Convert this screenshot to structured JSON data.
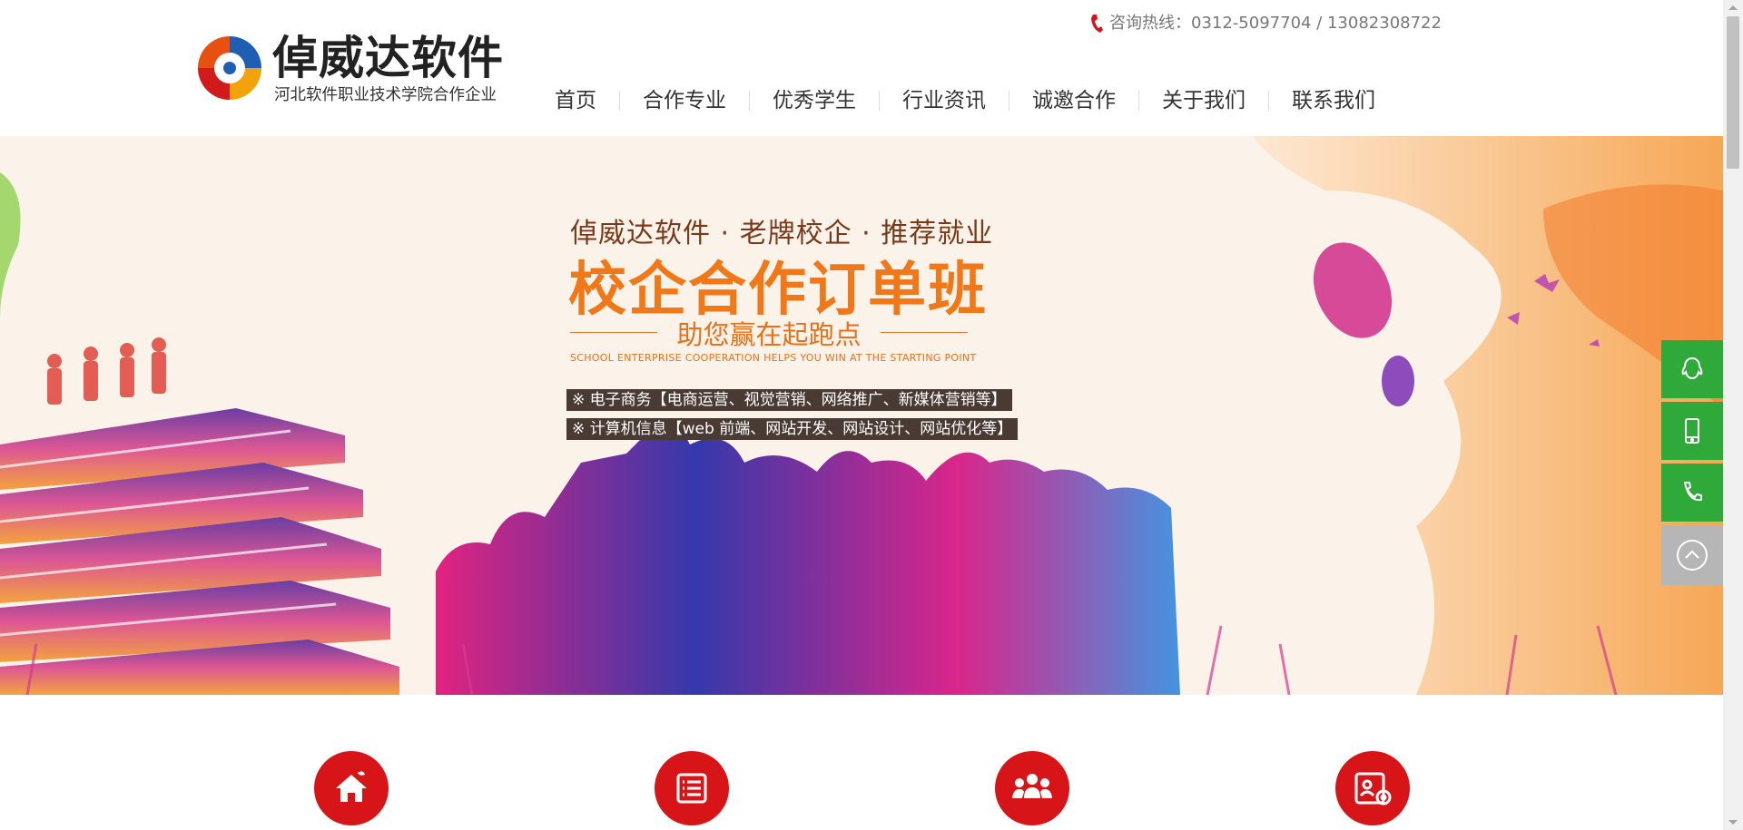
{
  "brand": {
    "name": "倬威达软件",
    "subtitle": "河北软件职业技术学院合作企业"
  },
  "hotline": {
    "text": "咨询热线：0312-5097704 / 13082308722"
  },
  "nav": {
    "items": [
      "首页",
      "合作专业",
      "优秀学生",
      "行业资讯",
      "诚邀合作",
      "关于我们",
      "联系我们"
    ]
  },
  "banner": {
    "tagline": "倬威达软件 · 老牌校企 · 推荐就业",
    "title": "校企合作订单班",
    "slogan": "助您赢在起跑点",
    "slogan_en": "SCHOOL ENTERPRISE COOPERATION HELPS YOU WIN AT THE STARTING POINT",
    "majors": [
      "※ 电子商务【电商运营、视觉营销、网络推广、新媒体营销等】",
      "※ 计算机信息【web 前端、网站开发、网站设计、网站优化等】"
    ]
  },
  "side_tools": [
    "qq-icon",
    "mobile-icon",
    "phone-icon",
    "back-to-top-icon"
  ],
  "features": [
    "home-icon",
    "list-icon",
    "team-icon",
    "certificate-icon"
  ],
  "colors": {
    "accent_red": "#d71518",
    "side_green": "#30a93b",
    "title_orange": "#f07818"
  }
}
